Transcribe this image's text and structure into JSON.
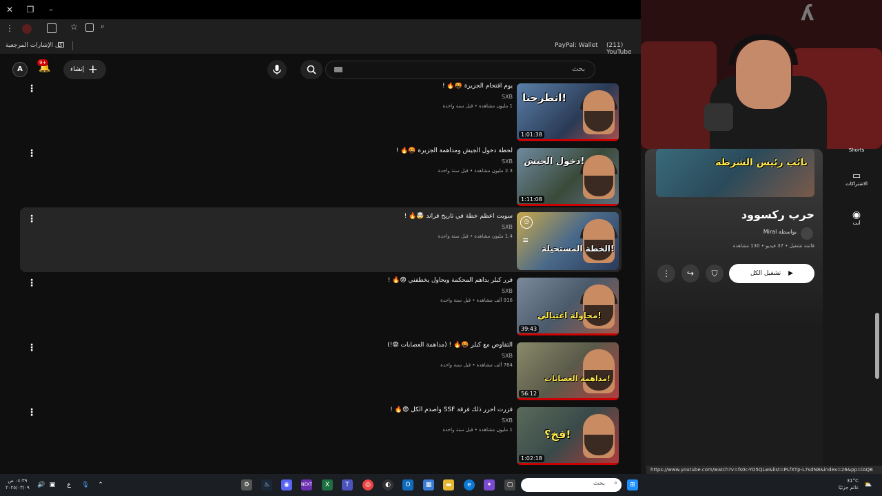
{
  "browser": {
    "bookmarks_folder": "كل الإشارات المرجعية",
    "bookmark_paypal": "PayPal: Wallet",
    "bookmark_youtube": "(211) YouTube"
  },
  "header": {
    "search_placeholder": "بحث",
    "create_label": "إنشاء",
    "notification_count": "9+",
    "avatar_letter": "A"
  },
  "videos": [
    {
      "title": "يوم اقتحام الجزيرة 🤬🔥 !",
      "channel": "SXB",
      "meta": "1 مليون مشاهدة • قبل سنة واحدة",
      "duration": "1:01:38",
      "overlay": "انطرحنا!"
    },
    {
      "title": "لحظة دخول الجيش ومداهمة الجزيرة 🤬🔥 !",
      "channel": "SXB",
      "meta": "2.3 مليون مشاهدة • قبل سنة واحدة",
      "duration": "1:11:08",
      "overlay": "دخول الجيش!"
    },
    {
      "title": "سويت اعظم خطة في تاريخ قراند 🤯🔥 !",
      "channel": "SXB",
      "meta": "1.4 مليون مشاهدة • قبل سنة واحدة",
      "duration": "",
      "overlay": "الخطة المستحيلة!"
    },
    {
      "title": "فرر كبلر بداهم المحكمة ويحاول يخطفني 😨🔥 !",
      "channel": "SXB",
      "meta": "916 ألف مشاهدة • قبل سنة واحدة",
      "duration": "39:43",
      "overlay": "محاولة اغتيالي!"
    },
    {
      "title": "التفاوض مع كبلر 🤬🔥 ! (مداهمة العصابات 😨!)",
      "channel": "SXB",
      "meta": "764 ألف مشاهدة • قبل سنة واحدة",
      "duration": "56:12",
      "overlay": "مداهمة العصابات!"
    },
    {
      "title": "فزرت احرر ذلك فرقة SSF واصدم الكل 😨🔥 !",
      "channel": "SXB",
      "meta": "1 مليون مشاهدة • قبل سنة واحدة",
      "duration": "1:02:18",
      "overlay": "فخ؟!"
    }
  ],
  "playlist": {
    "thumb_overlay": "نائب رئيس الشرطة",
    "title": "حرب ركسوود",
    "author": "بواسطة Miral",
    "meta": "قائمة تشغيل • 37 فيديو • 130 مشاهدة",
    "play_all_label": "تشغيل الكل"
  },
  "sidenav": {
    "shorts": "Shorts",
    "subscriptions": "الاشتراكات",
    "you": "أنت"
  },
  "status_url": "https://www.youtube.com/watch?v=fs0c-YO5QLw&list=PLfXTp-L7sdN8&index=26&pp=iAQB",
  "taskbar": {
    "search_placeholder": "بحث",
    "lang": "ع",
    "time": "٠٤:٣٩ ص",
    "date": "٢٠٢٥/٠٣/٠٩",
    "weather_temp": "31°C",
    "weather_desc": "غائم جزئيًا"
  },
  "colors": {
    "accent": "#cc0000",
    "background": "#0f0f0f",
    "active_row": "#262626"
  }
}
